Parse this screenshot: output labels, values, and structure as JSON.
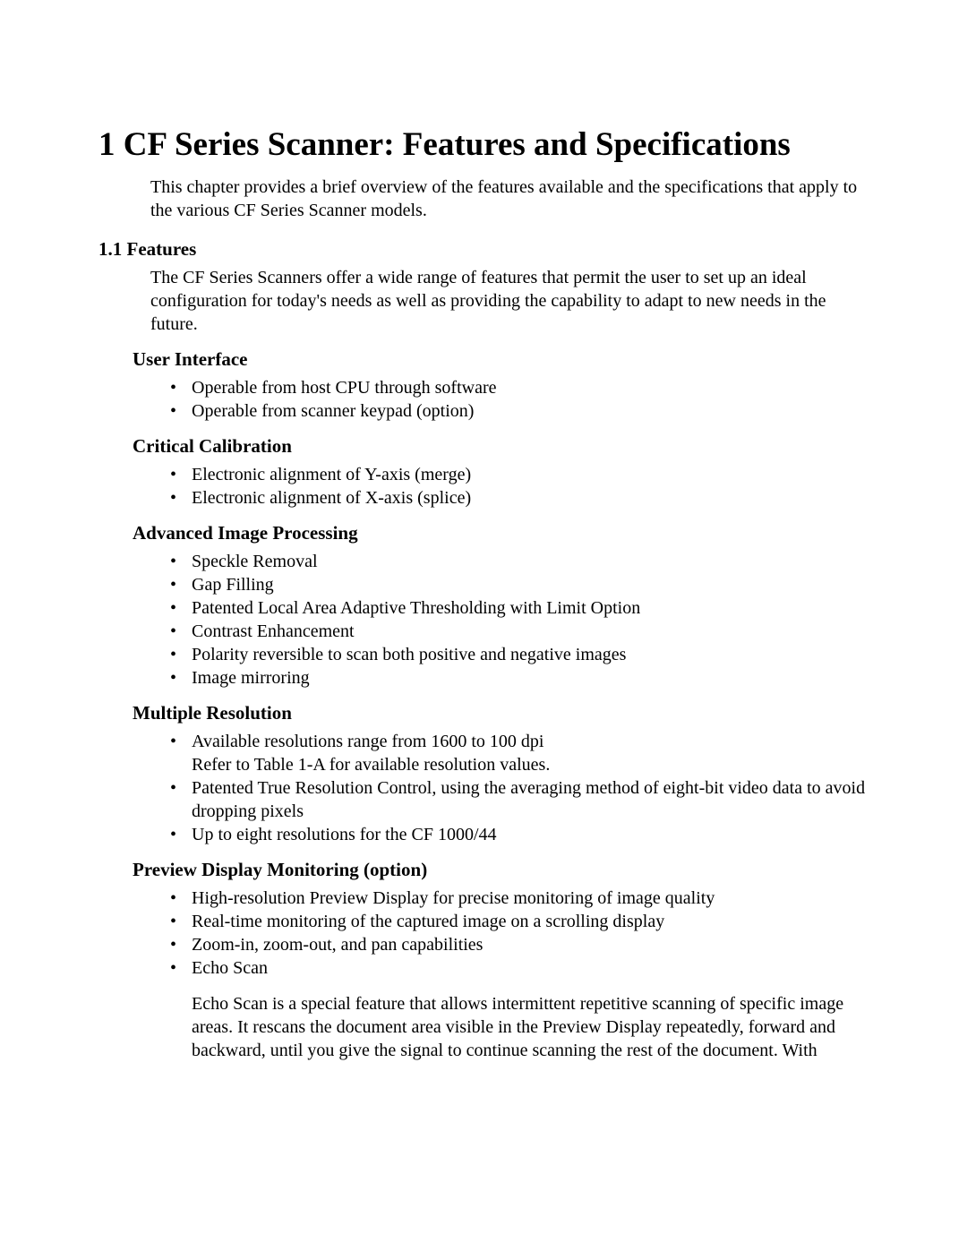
{
  "title": "1 CF Series Scanner: Features and Specifications",
  "intro": "This chapter provides a brief overview of the features available and the specifications that apply to the various CF Series Scanner models.",
  "features": {
    "heading": "1.1  Features",
    "intro": "The CF Series Scanners offer a wide range of features that permit the user to set up an ideal configuration for today's needs as well as providing the capability to adapt to new needs in the future.",
    "sections": {
      "userInterface": {
        "heading": "User Interface",
        "items": [
          "Operable from host CPU through software",
          "Operable from scanner keypad (option)"
        ]
      },
      "criticalCalibration": {
        "heading": "Critical Calibration",
        "items": [
          "Electronic alignment of Y-axis (merge)",
          "Electronic alignment of X-axis (splice)"
        ]
      },
      "advancedImageProcessing": {
        "heading": "Advanced Image Processing",
        "items": [
          "Speckle Removal",
          "Gap Filling",
          "Patented Local Area Adaptive Thresholding with Limit Option",
          "Contrast Enhancement",
          "Polarity reversible to scan both positive and negative images",
          "Image mirroring"
        ]
      },
      "multipleResolution": {
        "heading": "Multiple Resolution",
        "item0_line1": "Available resolutions range from 1600 to 100 dpi",
        "item0_line2": "Refer to Table 1-A for available resolution values.",
        "item1": "Patented True Resolution Control, using the averaging method of eight-bit video data to avoid dropping pixels",
        "item2": "Up to eight resolutions for the CF 1000/44"
      },
      "previewDisplay": {
        "heading": "Preview Display Monitoring (option)",
        "items": [
          "High-resolution Preview Display for precise monitoring of image quality",
          "Real-time monitoring of the captured image on a scrolling display",
          "Zoom-in, zoom-out, and pan capabilities",
          "Echo Scan"
        ],
        "echoPara": "Echo Scan is a special feature that allows intermittent repetitive scanning of specific image areas.  It rescans the document area visible in the Preview Display repeatedly, forward and backward, until you give the signal to continue scanning the rest of the document.  With"
      }
    }
  }
}
